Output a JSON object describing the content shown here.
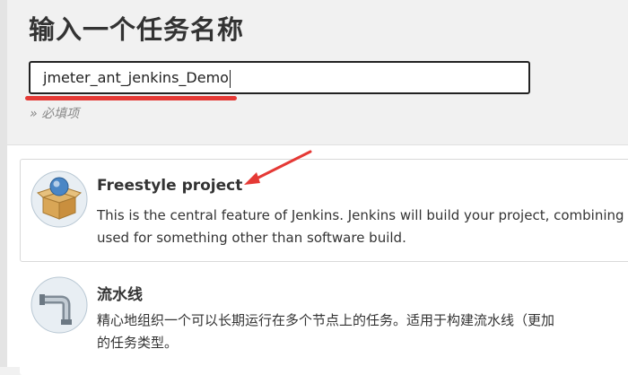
{
  "page": {
    "title": "输入一个任务名称"
  },
  "item_name": {
    "value": "jmeter_ant_jenkins_Demo",
    "hint": "» 必填项"
  },
  "job_types": [
    {
      "title": "Freestyle project",
      "description_line1": "This is the central feature of Jenkins. Jenkins will build your project, combining",
      "description_line2": "used for something other than software build.",
      "icon": "freestyle-box-icon"
    },
    {
      "title": "流水线",
      "description_line1": "精心地组织一个可以长期运行在多个节点上的任务。适用于构建流水线（更加",
      "description_line2": "的任务类型。",
      "icon": "pipeline-pipe-icon"
    }
  ],
  "annotations": {
    "color": "#e53935"
  }
}
